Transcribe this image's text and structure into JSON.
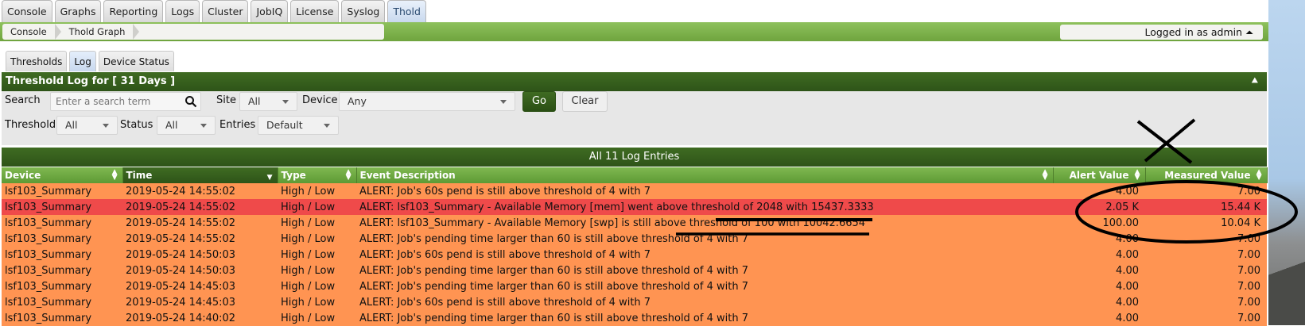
{
  "nav": {
    "tabs": [
      {
        "label": "Console"
      },
      {
        "label": "Graphs"
      },
      {
        "label": "Reporting"
      },
      {
        "label": "Logs"
      },
      {
        "label": "Cluster"
      },
      {
        "label": "JobIQ"
      },
      {
        "label": "License"
      },
      {
        "label": "Syslog"
      },
      {
        "label": "Thold",
        "active": true
      }
    ]
  },
  "breadcrumb": [
    {
      "label": "Console"
    },
    {
      "label": "Thold Graph"
    }
  ],
  "login": {
    "text": "Logged in as admin ⏶"
  },
  "subtabs": [
    {
      "label": "Thresholds"
    },
    {
      "label": "Log",
      "active": true
    },
    {
      "label": "Device Status"
    }
  ],
  "panel": {
    "title": "Threshold Log for [ 31 Days ]",
    "collapse_icon": "double-chevron-up-icon"
  },
  "filters": {
    "search_label": "Search",
    "search_placeholder": "Enter a search term",
    "site_label": "Site",
    "site_value": "All",
    "device_label": "Device",
    "device_value": "Any",
    "go_label": "Go",
    "clear_label": "Clear",
    "threshold_label": "Threshold",
    "threshold_value": "All",
    "status_label": "Status",
    "status_value": "All",
    "entries_label": "Entries",
    "entries_value": "Default"
  },
  "entries_title": "All 11 Log Entries",
  "table": {
    "columns": [
      "Device",
      "Time",
      "Type",
      "Event Description",
      "Alert Value",
      "Measured Value"
    ],
    "rows": [
      {
        "status": "warn",
        "device": "lsf103_Summary",
        "time": "2019-05-24 14:55:02",
        "type": "High / Low",
        "desc": "ALERT: Job's 60s pend is still above threshold of 4 with 7",
        "alert": "4.00",
        "measured": "7.00"
      },
      {
        "status": "alert",
        "device": "lsf103_Summary",
        "time": "2019-05-24 14:55:02",
        "type": "High / Low",
        "desc": "ALERT: lsf103_Summary - Available Memory [mem] went above threshold of 2048 with 15437.3333",
        "alert": "2.05 K",
        "measured": "15.44 K"
      },
      {
        "status": "warn",
        "device": "lsf103_Summary",
        "time": "2019-05-24 14:55:02",
        "type": "High / Low",
        "desc": "ALERT: lsf103_Summary - Available Memory [swp] is still above threshold of 100 with 10042.6654",
        "alert": "100.00",
        "measured": "10.04 K"
      },
      {
        "status": "warn",
        "device": "lsf103_Summary",
        "time": "2019-05-24 14:55:02",
        "type": "High / Low",
        "desc": "ALERT: Job's pending time larger than 60 is still above threshold of 4 with 7",
        "alert": "4.00",
        "measured": "7.00"
      },
      {
        "status": "warn",
        "device": "lsf103_Summary",
        "time": "2019-05-24 14:50:03",
        "type": "High / Low",
        "desc": "ALERT: Job's 60s pend is still above threshold of 4 with 7",
        "alert": "4.00",
        "measured": "7.00"
      },
      {
        "status": "warn",
        "device": "lsf103_Summary",
        "time": "2019-05-24 14:50:03",
        "type": "High / Low",
        "desc": "ALERT: Job's pending time larger than 60 is still above threshold of 4 with 7",
        "alert": "4.00",
        "measured": "7.00"
      },
      {
        "status": "warn",
        "device": "lsf103_Summary",
        "time": "2019-05-24 14:45:03",
        "type": "High / Low",
        "desc": "ALERT: Job's pending time larger than 60 is still above threshold of 4 with 7",
        "alert": "4.00",
        "measured": "7.00"
      },
      {
        "status": "warn",
        "device": "lsf103_Summary",
        "time": "2019-05-24 14:45:03",
        "type": "High / Low",
        "desc": "ALERT: Job's 60s pend is still above threshold of 4 with 7",
        "alert": "4.00",
        "measured": "7.00"
      },
      {
        "status": "warn",
        "device": "lsf103_Summary",
        "time": "2019-05-24 14:40:02",
        "type": "High / Low",
        "desc": "ALERT: Job's pending time larger than 60 is still above threshold of 4 with 7",
        "alert": "4.00",
        "measured": "7.00"
      }
    ]
  },
  "colors": {
    "warn_row": "#ff9452",
    "alert_row": "#ef4a4a",
    "header_green": "#2e5418"
  }
}
